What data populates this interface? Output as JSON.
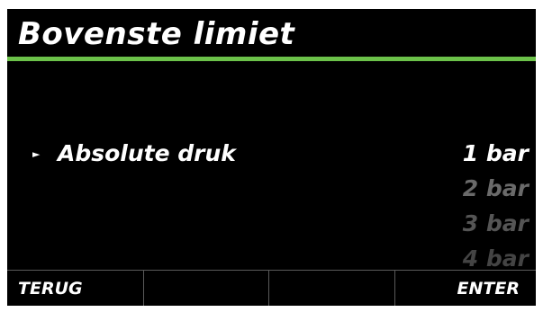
{
  "screen": {
    "title": "Bovenste limiet",
    "accent_color": "#6cc24a",
    "background_color": "#000000"
  },
  "setting": {
    "label": "Absolute druk",
    "pointer_icon": "triangle-right-icon"
  },
  "options": [
    {
      "label": "1 bar",
      "selected": true,
      "color": "#ffffff"
    },
    {
      "label": "2 bar",
      "selected": false,
      "color": "#6a6a6a"
    },
    {
      "label": "3 bar",
      "selected": false,
      "color": "#555555"
    },
    {
      "label": "4 bar",
      "selected": false,
      "color": "#444444"
    }
  ],
  "softkeys": [
    {
      "label": "TERUG"
    },
    {
      "label": ""
    },
    {
      "label": ""
    },
    {
      "label": "ENTER"
    }
  ]
}
